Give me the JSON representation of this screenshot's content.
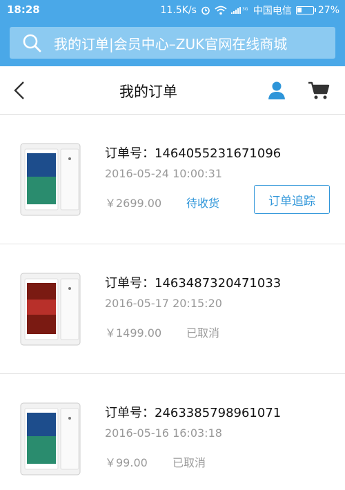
{
  "status_bar": {
    "time": "18:28",
    "speed": "11.5K/s",
    "carrier": "中国电信",
    "battery": "27%"
  },
  "browser": {
    "url_title": "我的订单|会员中心–ZUK官网在线商城"
  },
  "header": {
    "title": "我的订单"
  },
  "orders": [
    {
      "number": "订单号：1464055231671096",
      "date": "2016-05-24 10:00:31",
      "price": "￥2699.00",
      "status": "待收货",
      "action": "订单追踪",
      "phone_color": "blue"
    },
    {
      "number": "订单号：1463487320471033",
      "date": "2016-05-17 20:15:20",
      "price": "￥1499.00",
      "status": "已取消",
      "phone_color": "red"
    },
    {
      "number": "订单号：2463385798961071",
      "date": "2016-05-16 16:03:18",
      "price": "￥99.00",
      "status": "已取消",
      "phone_color": "blue"
    }
  ],
  "colors": {
    "brand_blue": "#4aa8e8",
    "accent": "#2e95d9"
  }
}
